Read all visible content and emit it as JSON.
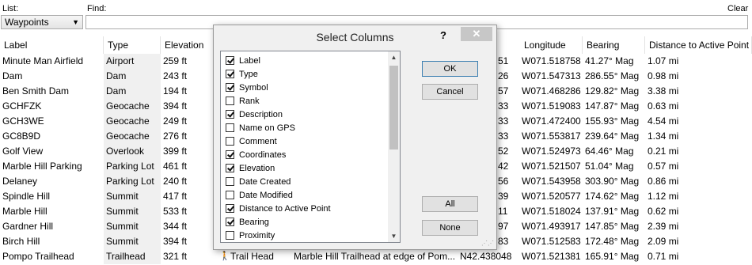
{
  "toolbar": {
    "list_label": "List:",
    "list_value": "Waypoints",
    "find_label": "Find:",
    "clear_label": "Clear",
    "find_value": ""
  },
  "columns": {
    "label": "Label",
    "type": "Type",
    "elevation": "Elevation",
    "longitude": "Longitude",
    "bearing": "Bearing",
    "distance": "Distance to Active Point"
  },
  "rows": [
    {
      "label": "Minute Man Airfield",
      "type": "Airport",
      "elevation": "259 ft",
      "lat_frag": "51",
      "longitude": "W071.518758",
      "bearing": "41.27° Mag",
      "distance": "1.07 mi"
    },
    {
      "label": "Dam",
      "type": "Dam",
      "elevation": "243 ft",
      "lat_frag": "26",
      "longitude": "W071.547313",
      "bearing": "286.55° Mag",
      "distance": "0.98 mi"
    },
    {
      "label": "Ben Smith Dam",
      "type": "Dam",
      "elevation": "194 ft",
      "lat_frag": "57",
      "longitude": "W071.468286",
      "bearing": "129.82° Mag",
      "distance": "3.38 mi"
    },
    {
      "label": "GCHFZK",
      "type": "Geocache",
      "elevation": "394 ft",
      "lat_frag": "33",
      "longitude": "W071.519083",
      "bearing": "147.87° Mag",
      "distance": "0.63 mi"
    },
    {
      "label": "GCH3WE",
      "type": "Geocache",
      "elevation": "249 ft",
      "lat_frag": "33",
      "longitude": "W071.472400",
      "bearing": "155.93° Mag",
      "distance": "4.54 mi"
    },
    {
      "label": "GC8B9D",
      "type": "Geocache",
      "elevation": "276 ft",
      "lat_frag": "33",
      "longitude": "W071.553817",
      "bearing": "239.64° Mag",
      "distance": "1.34 mi"
    },
    {
      "label": "Golf View",
      "type": "Overlook",
      "elevation": "399 ft",
      "lat_frag": "52",
      "longitude": "W071.524973",
      "bearing": "64.46° Mag",
      "distance": "0.21 mi"
    },
    {
      "label": "Marble Hill Parking",
      "type": "Parking Lot",
      "elevation": "461 ft",
      "lat_frag": "42",
      "longitude": "W071.521507",
      "bearing": "51.04° Mag",
      "distance": "0.57 mi"
    },
    {
      "label": "Delaney",
      "type": "Parking Lot",
      "elevation": "240 ft",
      "lat_frag": "56",
      "longitude": "W071.543958",
      "bearing": "303.90° Mag",
      "distance": "0.86 mi"
    },
    {
      "label": "Spindle Hill",
      "type": "Summit",
      "elevation": "417 ft",
      "lat_frag": "39",
      "longitude": "W071.520577",
      "bearing": "174.62° Mag",
      "distance": "1.12 mi"
    },
    {
      "label": "Marble Hill",
      "type": "Summit",
      "elevation": "533 ft",
      "lat_frag": "11",
      "longitude": "W071.518024",
      "bearing": "137.91° Mag",
      "distance": "0.62 mi"
    },
    {
      "label": "Gardner Hill",
      "type": "Summit",
      "elevation": "344 ft",
      "lat_frag": "97",
      "longitude": "W071.493917",
      "bearing": "147.85° Mag",
      "distance": "2.39 mi"
    },
    {
      "label": "Birch Hill",
      "type": "Summit",
      "elevation": "394 ft",
      "lat_frag": "83",
      "longitude": "W071.512583",
      "bearing": "172.48° Mag",
      "distance": "2.09 mi"
    },
    {
      "label": "Pompo Trailhead",
      "type": "Trailhead",
      "elevation": "321 ft",
      "symbol": "Trail Head",
      "description": "Marble Hill Trailhead at edge of Pom...",
      "latitude": "N42.438048",
      "longitude": "W071.521381",
      "bearing": "165.91° Mag",
      "distance": "0.71 mi"
    }
  ],
  "dialog": {
    "title": "Select Columns",
    "help": "?",
    "close": "✕",
    "ok": "OK",
    "cancel": "Cancel",
    "all": "All",
    "none": "None",
    "items": [
      {
        "label": "Label",
        "checked": true
      },
      {
        "label": "Type",
        "checked": true
      },
      {
        "label": "Symbol",
        "checked": true
      },
      {
        "label": "Rank",
        "checked": false
      },
      {
        "label": "Description",
        "checked": true
      },
      {
        "label": "Name on GPS",
        "checked": false
      },
      {
        "label": "Comment",
        "checked": false
      },
      {
        "label": "Coordinates",
        "checked": true
      },
      {
        "label": "Elevation",
        "checked": true
      },
      {
        "label": "Date Created",
        "checked": false
      },
      {
        "label": "Date Modified",
        "checked": false
      },
      {
        "label": "Distance to Active Point",
        "checked": true
      },
      {
        "label": "Bearing",
        "checked": true
      },
      {
        "label": "Proximity",
        "checked": false
      }
    ]
  }
}
